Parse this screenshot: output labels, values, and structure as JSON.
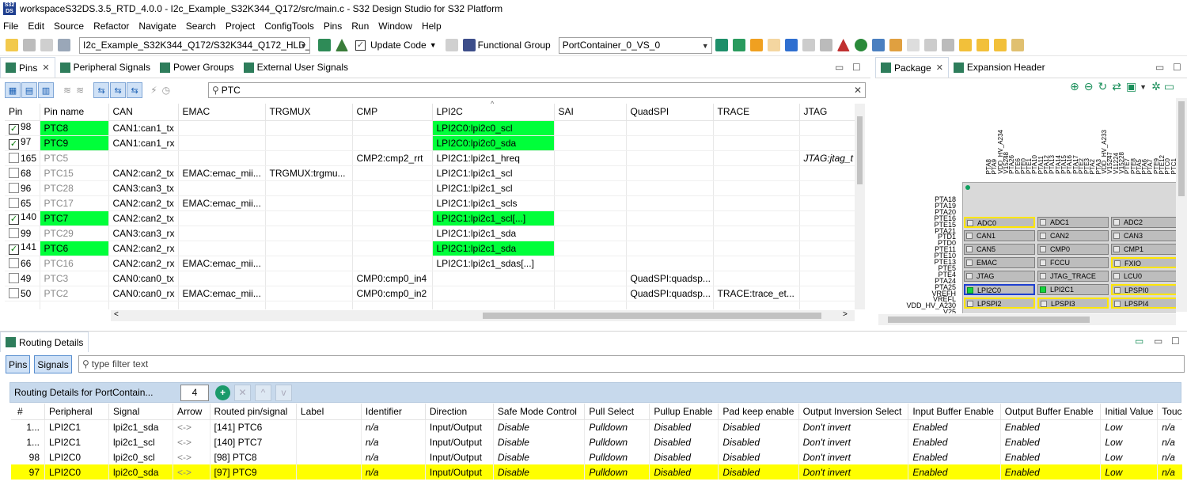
{
  "window": {
    "title": "workspaceS32DS.3.5_RTD_4.0.0 - I2c_Example_S32K344_Q172/src/main.c - S32 Design Studio for S32 Platform"
  },
  "menu": [
    "File",
    "Edit",
    "Source",
    "Refactor",
    "Navigate",
    "Search",
    "Project",
    "ConfigTools",
    "Pins",
    "Run",
    "Window",
    "Help"
  ],
  "toolbar": {
    "project_combo": "I2c_Example_S32K344_Q172/S32K344_Q172_HLD_FI",
    "update_code": "Update Code",
    "functional_group_label": "Functional Group",
    "functional_group_value": "PortContainer_0_VS_0"
  },
  "pins_view": {
    "tabs": [
      "Pins",
      "Peripheral Signals",
      "Power Groups",
      "External User Signals"
    ],
    "search": "PTC",
    "columns": [
      "Pin",
      "Pin name",
      "CAN",
      "EMAC",
      "TRGMUX",
      "CMP",
      "LPI2C",
      "SAI",
      "QuadSPI",
      "TRACE",
      "JTAG"
    ],
    "rows": [
      {
        "checked": true,
        "pin": "98",
        "name": "PTC8",
        "can": "CAN1:can1_tx",
        "emac": "",
        "trgmux": "",
        "cmp": "",
        "lpi2c": "LPI2C0:lpi2c0_scl",
        "sai": "",
        "quadspi": "",
        "trace": "",
        "jtag": "",
        "green": true
      },
      {
        "checked": true,
        "pin": "97",
        "name": "PTC9",
        "can": "CAN1:can1_rx",
        "emac": "",
        "trgmux": "",
        "cmp": "",
        "lpi2c": "LPI2C0:lpi2c0_sda",
        "sai": "",
        "quadspi": "",
        "trace": "",
        "jtag": "",
        "green": true
      },
      {
        "checked": false,
        "pin": "165",
        "name": "PTC5",
        "can": "",
        "emac": "",
        "trgmux": "",
        "cmp": "CMP2:cmp2_rrt",
        "lpi2c": "LPI2C1:lpi2c1_hreq",
        "sai": "",
        "quadspi": "",
        "trace": "",
        "jtag": "JTAG:jtag_t",
        "green": false
      },
      {
        "checked": false,
        "pin": "68",
        "name": "PTC15",
        "can": "CAN2:can2_tx",
        "emac": "EMAC:emac_mii...",
        "trgmux": "TRGMUX:trgmu...",
        "cmp": "",
        "lpi2c": "LPI2C1:lpi2c1_scl",
        "sai": "",
        "quadspi": "",
        "trace": "",
        "jtag": "",
        "green": false
      },
      {
        "checked": false,
        "pin": "96",
        "name": "PTC28",
        "can": "CAN3:can3_tx",
        "emac": "",
        "trgmux": "",
        "cmp": "",
        "lpi2c": "LPI2C1:lpi2c1_scl",
        "sai": "",
        "quadspi": "",
        "trace": "",
        "jtag": "",
        "green": false
      },
      {
        "checked": false,
        "pin": "65",
        "name": "PTC17",
        "can": "CAN2:can2_tx",
        "emac": "EMAC:emac_mii...",
        "trgmux": "",
        "cmp": "",
        "lpi2c": "LPI2C1:lpi2c1_scls",
        "sai": "",
        "quadspi": "",
        "trace": "",
        "jtag": "",
        "green": false
      },
      {
        "checked": true,
        "pin": "140",
        "name": "PTC7",
        "can": "CAN2:can2_tx",
        "emac": "",
        "trgmux": "",
        "cmp": "",
        "lpi2c": "LPI2C1:lpi2c1_scl[...]",
        "sai": "",
        "quadspi": "",
        "trace": "",
        "jtag": "",
        "green": true
      },
      {
        "checked": false,
        "pin": "99",
        "name": "PTC29",
        "can": "CAN3:can3_rx",
        "emac": "",
        "trgmux": "",
        "cmp": "",
        "lpi2c": "LPI2C1:lpi2c1_sda",
        "sai": "",
        "quadspi": "",
        "trace": "",
        "jtag": "",
        "green": false
      },
      {
        "checked": true,
        "pin": "141",
        "name": "PTC6",
        "can": "CAN2:can2_rx",
        "emac": "",
        "trgmux": "",
        "cmp": "",
        "lpi2c": "LPI2C1:lpi2c1_sda",
        "sai": "",
        "quadspi": "",
        "trace": "",
        "jtag": "",
        "green": true
      },
      {
        "checked": false,
        "pin": "66",
        "name": "PTC16",
        "can": "CAN2:can2_rx",
        "emac": "EMAC:emac_mii...",
        "trgmux": "",
        "cmp": "",
        "lpi2c": "LPI2C1:lpi2c1_sdas[...]",
        "sai": "",
        "quadspi": "",
        "trace": "",
        "jtag": "",
        "green": false
      },
      {
        "checked": false,
        "pin": "49",
        "name": "PTC3",
        "can": "CAN0:can0_tx",
        "emac": "",
        "trgmux": "",
        "cmp": "CMP0:cmp0_in4",
        "lpi2c": "",
        "sai": "",
        "quadspi": "QuadSPI:quadsp...",
        "trace": "",
        "jtag": "",
        "green": false
      },
      {
        "checked": false,
        "pin": "50",
        "name": "PTC2",
        "can": "CAN0:can0_rx",
        "emac": "EMAC:emac_mii...",
        "trgmux": "",
        "cmp": "CMP0:cmp0_in2",
        "lpi2c": "",
        "sai": "",
        "quadspi": "QuadSPI:quadsp...",
        "trace": "TRACE:trace_et...",
        "jtag": "",
        "green": false
      }
    ]
  },
  "package_view": {
    "tabs": [
      "Package",
      "Expansion Header"
    ],
    "left_pins": [
      "PTA18",
      "PTA19",
      "PTA20",
      "PTE16",
      "PTE15",
      "PTA21",
      "PTD1",
      "PTD0",
      "PTE11",
      "PTE10",
      "PTE13",
      "PTE5",
      "PTE4",
      "PTA24",
      "PTA25",
      "VREFH",
      "VREFL",
      "VDD_HV_A230",
      "V25"
    ],
    "top_pins": [
      "PTA8",
      "PTA9",
      "VDD_HV_A234",
      "V15248",
      "PTA26",
      "PTE6",
      "PTE0",
      "PTE1",
      "PTA10",
      "PTA11",
      "PTA12",
      "PTA13",
      "PTA14",
      "PTA15",
      "PTA16",
      "PTA17",
      "PTE2",
      "PTE3",
      "PTA2",
      "PTA3",
      "VDD_HV_A233",
      "V15247",
      "V11224",
      "V15228",
      "PTE7",
      "PTE8",
      "PTA5",
      "PTA6",
      "PTA7",
      "PTE9",
      "PTE12",
      "PTC0",
      "PTC1"
    ],
    "blocks": [
      [
        "ADC0",
        "ADC1",
        "ADC2"
      ],
      [
        "CAN1",
        "CAN2",
        "CAN3"
      ],
      [
        "CAN5",
        "CMP0",
        "CMP1"
      ],
      [
        "EMAC",
        "FCCU",
        "FXIO"
      ],
      [
        "JTAG",
        "JTAG_TRACE",
        "LCU0"
      ],
      [
        "LPI2C0",
        "LPI2C1",
        "LPSPI0"
      ],
      [
        "LPSPI2",
        "LPSPI3",
        "LPSPI4"
      ]
    ]
  },
  "routing": {
    "title": "Routing Details",
    "filter_buttons": [
      "Pins",
      "Signals"
    ],
    "filter_placeholder": "type filter text",
    "header_label": "Routing Details for PortContain...",
    "count": "4",
    "columns": [
      "#",
      "Peripheral",
      "Signal",
      "Arrow",
      "Routed pin/signal",
      "Label",
      "Identifier",
      "Direction",
      "Safe Mode Control",
      "Pull Select",
      "Pullup Enable",
      "Pad keep enable",
      "Output Inversion Select",
      "Input Buffer Enable",
      "Output Buffer Enable",
      "Initial Value",
      "Touch"
    ],
    "rows": [
      {
        "n": "1...",
        "periph": "LPI2C1",
        "signal": "lpi2c1_sda",
        "arrow": "<->",
        "routed": "[141] PTC6",
        "label": "",
        "ident": "n/a",
        "dir": "Input/Output",
        "safe": "Disable",
        "pull": "Pulldown",
        "pullup": "Disabled",
        "padkeep": "Disabled",
        "outinv": "Don't invert",
        "inbuf": "Enabled",
        "outbuf": "Enabled",
        "init": "Low",
        "touch": "n/a",
        "hl": false
      },
      {
        "n": "1...",
        "periph": "LPI2C1",
        "signal": "lpi2c1_scl",
        "arrow": "<->",
        "routed": "[140] PTC7",
        "label": "",
        "ident": "n/a",
        "dir": "Input/Output",
        "safe": "Disable",
        "pull": "Pulldown",
        "pullup": "Disabled",
        "padkeep": "Disabled",
        "outinv": "Don't invert",
        "inbuf": "Enabled",
        "outbuf": "Enabled",
        "init": "Low",
        "touch": "n/a",
        "hl": false
      },
      {
        "n": "98",
        "periph": "LPI2C0",
        "signal": "lpi2c0_scl",
        "arrow": "<->",
        "routed": "[98] PTC8",
        "label": "",
        "ident": "n/a",
        "dir": "Input/Output",
        "safe": "Disable",
        "pull": "Pulldown",
        "pullup": "Disabled",
        "padkeep": "Disabled",
        "outinv": "Don't invert",
        "inbuf": "Enabled",
        "outbuf": "Enabled",
        "init": "Low",
        "touch": "n/a",
        "hl": false
      },
      {
        "n": "97",
        "periph": "LPI2C0",
        "signal": "lpi2c0_sda",
        "arrow": "<->",
        "routed": "[97] PTC9",
        "label": "",
        "ident": "n/a",
        "dir": "Input/Output",
        "safe": "Disable",
        "pull": "Pulldown",
        "pullup": "Disabled",
        "padkeep": "Disabled",
        "outinv": "Don't invert",
        "inbuf": "Enabled",
        "outbuf": "Enabled",
        "init": "Low",
        "touch": "n/a",
        "hl": true
      }
    ]
  },
  "colors": {
    "pin_green": "#00ff3a",
    "highlight_yellow": "#ffff00",
    "selection_blue": "#cfe1f6"
  }
}
